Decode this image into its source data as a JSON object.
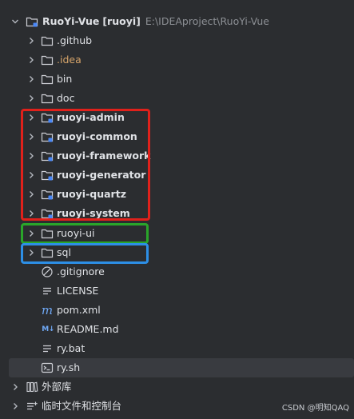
{
  "project": {
    "name": "RuoYi-Vue",
    "module_tag": "[ruoyi]",
    "path": "E:\\IDEAproject\\RuoYi-Vue"
  },
  "items": [
    {
      "label": ".github",
      "type": "folder"
    },
    {
      "label": ".idea",
      "type": "folder"
    },
    {
      "label": "bin",
      "type": "folder"
    },
    {
      "label": "doc",
      "type": "folder"
    },
    {
      "label": "ruoyi-admin",
      "type": "module"
    },
    {
      "label": "ruoyi-common",
      "type": "module"
    },
    {
      "label": "ruoyi-framework",
      "type": "module"
    },
    {
      "label": "ruoyi-generator",
      "type": "module"
    },
    {
      "label": "ruoyi-quartz",
      "type": "module"
    },
    {
      "label": "ruoyi-system",
      "type": "module"
    },
    {
      "label": "ruoyi-ui",
      "type": "folder"
    },
    {
      "label": "sql",
      "type": "folder"
    },
    {
      "label": ".gitignore",
      "type": "ignore-file"
    },
    {
      "label": "LICENSE",
      "type": "text-file"
    },
    {
      "label": "pom.xml",
      "type": "maven-file"
    },
    {
      "label": "README.md",
      "type": "markdown-file"
    },
    {
      "label": "ry.bat",
      "type": "text-file"
    },
    {
      "label": "ry.sh",
      "type": "shell-file"
    }
  ],
  "external_libraries": {
    "label": "外部库"
  },
  "scratches": {
    "label": "临时文件和控制台"
  },
  "markdown_icon_text": "M↓",
  "maven_icon_text": "m",
  "watermark": "CSDN @明知QAQ",
  "colors": {
    "background": "#2b2d30",
    "selection": "#393b40",
    "red_box": "#e0211b",
    "green_box": "#2aa52a",
    "blue_box": "#2d8fe6",
    "excluded_folder": "#d6a46a"
  }
}
